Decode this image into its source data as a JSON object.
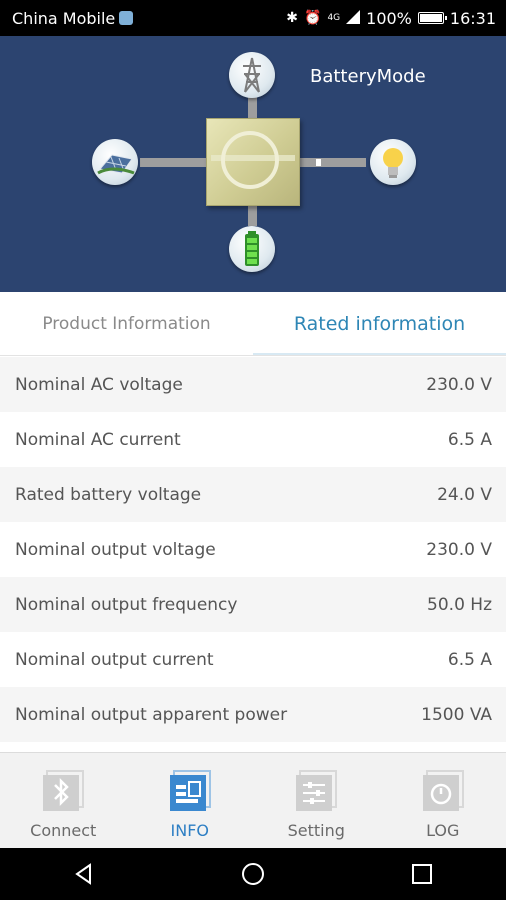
{
  "status_bar": {
    "carrier": "China Mobile",
    "signal_text": "4G",
    "battery_percent": "100%",
    "time": "16:31"
  },
  "header": {
    "mode": "BatteryMode"
  },
  "tabs": [
    {
      "label": "Product Information",
      "active": false
    },
    {
      "label": "Rated information",
      "active": true
    }
  ],
  "rated_info": [
    {
      "label": "Nominal AC voltage",
      "value": "230.0 V"
    },
    {
      "label": "Nominal AC current",
      "value": "6.5 A"
    },
    {
      "label": "Rated battery voltage",
      "value": "24.0 V"
    },
    {
      "label": "Nominal output voltage",
      "value": "230.0 V"
    },
    {
      "label": "Nominal output frequency",
      "value": "50.0 Hz"
    },
    {
      "label": "Nominal output current",
      "value": "6.5 A"
    },
    {
      "label": "Nominal output apparent power",
      "value": "1500 VA"
    }
  ],
  "bottom_nav": [
    {
      "label": "Connect",
      "icon": "bluetooth-icon",
      "active": false
    },
    {
      "label": "INFO",
      "icon": "info-icon",
      "active": true
    },
    {
      "label": "Setting",
      "icon": "settings-icon",
      "active": false
    },
    {
      "label": "LOG",
      "icon": "log-icon",
      "active": false
    }
  ],
  "colors": {
    "header_bg": "#2c4470",
    "accent": "#2e86b5",
    "battery_green": "#3fbf2f"
  }
}
